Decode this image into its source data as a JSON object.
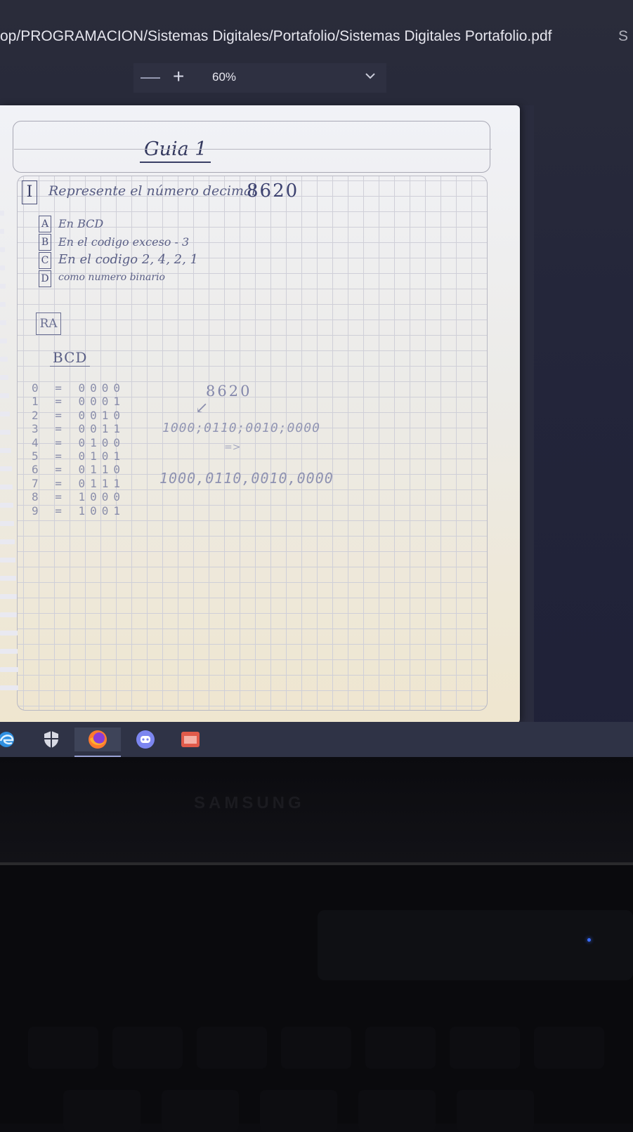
{
  "window": {
    "file_path": "op/PROGRAMACION/Sistemas Digitales/Portafolio/Sistemas Digitales Portafolio.pdf",
    "path_trailing": "S"
  },
  "pdf_toolbar": {
    "zoom_out_label": "—",
    "zoom_in_label": "+",
    "zoom_value": "60%",
    "zoom_dropdown_icon": "chevron-down-icon"
  },
  "page": {
    "title": "Guia 1",
    "question_number": "I",
    "question_text": "Represente el número decimal",
    "question_value": "8620",
    "options": [
      {
        "letter": "A",
        "text": "En BCD"
      },
      {
        "letter": "B",
        "text": "En el codigo exceso - 3"
      },
      {
        "letter": "C",
        "text": "En el codigo 2, 4, 2, 1"
      },
      {
        "letter": "D",
        "text": "como numero binario"
      }
    ],
    "answer_label": "RA",
    "bcd_heading": "BCD",
    "bcd_table": [
      "0 = 0000",
      "1 = 0001",
      "2 = 0010",
      "3 = 0011",
      "4 = 0100",
      "5 = 0101",
      "6 = 0110",
      "7 = 0111",
      "8 = 1000",
      "9 = 1001"
    ],
    "work_number": "8620",
    "work_line_1": "1000;0110;0010;0000",
    "work_arrow": "=>",
    "work_line_2": "1000,0110,0010,0000"
  },
  "taskbar": {
    "icons": [
      "edge-icon",
      "shield-icon",
      "firefox-icon",
      "discord-icon",
      "pdf-reader-icon"
    ]
  },
  "device": {
    "brand": "SAMSUNG"
  }
}
